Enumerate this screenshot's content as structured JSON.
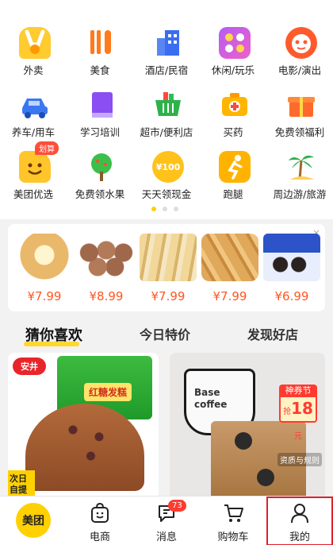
{
  "grid": {
    "row1": [
      {
        "label": "外卖",
        "icon": "takeout-icon"
      },
      {
        "label": "美食",
        "icon": "food-icon"
      },
      {
        "label": "酒店/民宿",
        "icon": "hotel-icon"
      },
      {
        "label": "休闲/玩乐",
        "icon": "leisure-icon"
      },
      {
        "label": "电影/演出",
        "icon": "movie-icon"
      }
    ],
    "row2": [
      {
        "label": "养车/用车",
        "icon": "car-icon"
      },
      {
        "label": "学习培训",
        "icon": "book-icon"
      },
      {
        "label": "超市/便利店",
        "icon": "basket-icon"
      },
      {
        "label": "买药",
        "icon": "medicine-icon"
      },
      {
        "label": "免费领福利",
        "icon": "gift-icon"
      }
    ],
    "row3": [
      {
        "label": "美团优选",
        "icon": "smile-icon",
        "badge": "划算"
      },
      {
        "label": "免费领水果",
        "icon": "tree-icon"
      },
      {
        "label": "天天领现金",
        "icon": "coin-icon",
        "coin_text": "¥100"
      },
      {
        "label": "跑腿",
        "icon": "runner-icon"
      },
      {
        "label": "周边游/旅游",
        "icon": "palm-icon"
      }
    ]
  },
  "products": [
    {
      "price": "¥7.99",
      "name": "bread-image"
    },
    {
      "price": "¥8.99",
      "name": "cookies-image"
    },
    {
      "price": "¥7.99",
      "name": "snack-pack-image"
    },
    {
      "price": "¥7.99",
      "name": "pastry-image"
    },
    {
      "price": "¥6.99",
      "name": "oreo-image"
    }
  ],
  "products_close": "×",
  "tabs": [
    "猜你喜欢",
    "今日特价",
    "发现好店"
  ],
  "cards": {
    "left": {
      "brand_logo": "安井",
      "pack_text": "红糖发糕",
      "corner_text": "次日自提"
    },
    "right": {
      "cup_text": "Base coffee",
      "festival_label": "神券节",
      "coupon_prefix": "抢",
      "coupon_amount": "18",
      "coupon_unit": "元",
      "qualify_text": "资质与规则"
    }
  },
  "nav": {
    "home": "美团",
    "ecommerce": "电商",
    "messages": "消息",
    "messages_count": "73",
    "cart": "购物车",
    "mine": "我的"
  },
  "colors": {
    "brand_yellow": "#ffd100",
    "price_orange": "#ff5722",
    "highlight_red": "#e0202a"
  }
}
